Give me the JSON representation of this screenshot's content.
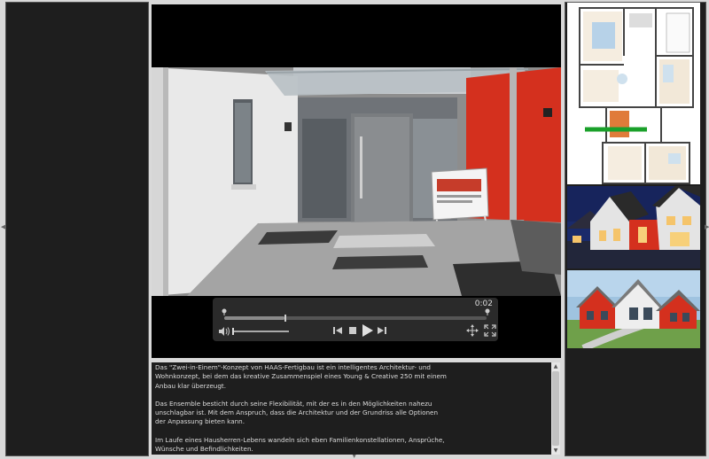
{
  "player": {
    "time": "0:02",
    "progress": 0.23
  },
  "description": {
    "paragraphs": [
      "Das \"Zwei-in-Einem\"-Konzept von HAAS-Fertigbau ist ein intelligentes Architektur- und Wohnkonzept, bei dem das kreative Zusammenspiel eines Young & Creative 250 mit einem Anbau klar überzeugt.",
      "Das Ensemble besticht durch seine Flexibilität, mit der es in den Möglichkeiten nahezu unschlagbar ist. Mit dem Anspruch, dass die Architektur und der Grundriss alle Optionen der Anpassung bieten kann.",
      "Im Laufe eines Hausherren-Lebens wandeln sich eben Familienkonstellationen, Ansprüche, Wünsche und Befindlichkeiten."
    ]
  },
  "icons": {
    "pin": "location-pin-icon",
    "volume": "volume-icon",
    "prev": "skip-back-icon",
    "stop": "stop-icon",
    "play": "play-icon",
    "next": "skip-forward-icon",
    "move": "move-icon",
    "fullscreen": "fullscreen-icon"
  },
  "colors": {
    "panel": "#1e1e1e",
    "background": "#d9d9d9",
    "accent_red": "#d4301e",
    "floorplan_marker": "#1aa02a"
  }
}
